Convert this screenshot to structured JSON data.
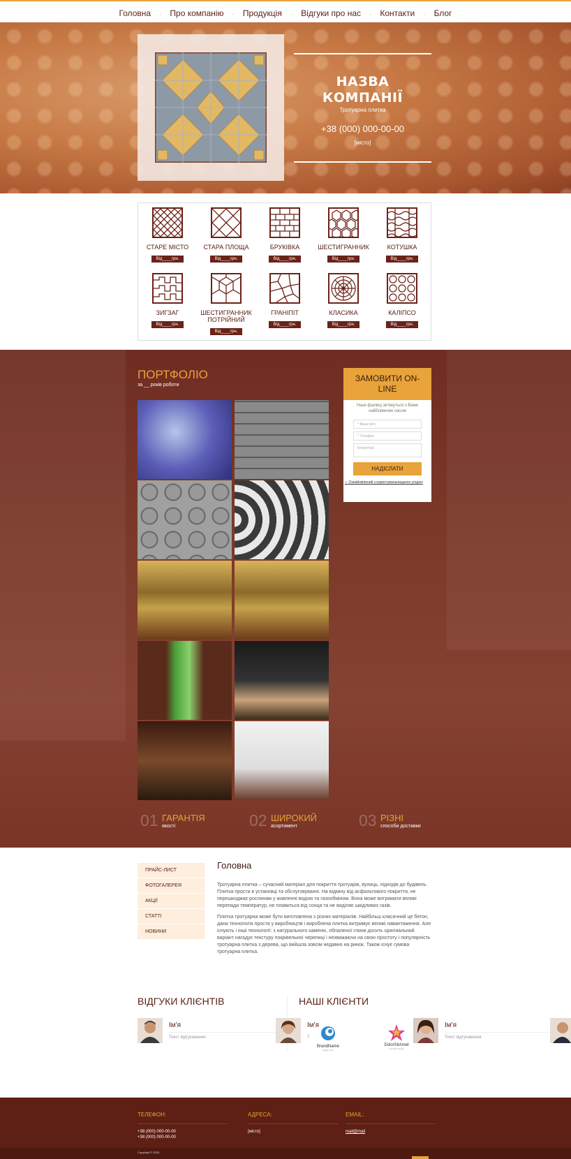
{
  "nav": {
    "items": [
      "Головна",
      "Про компанію",
      "Продукція",
      "Відгуки про нас",
      "Контакти",
      "Блог"
    ],
    "separator": "·"
  },
  "hero": {
    "title_line1": "НАЗВА",
    "title_line2": "КОМПАНІЇ",
    "subtitle": "Тротуарна плитка",
    "phone": "+38 (000) 000-00-00",
    "city": "[місто]"
  },
  "products": [
    {
      "name": "СТАРЕ МІСТО",
      "price": "Від____грн.",
      "icon": "diagonal-grid-icon"
    },
    {
      "name": "СТАРА ПЛОЩА",
      "price": "Від____грн.",
      "icon": "diamond-lattice-icon"
    },
    {
      "name": "БРУКІВКА",
      "price": "Від____грн.",
      "icon": "brick-pattern-icon"
    },
    {
      "name": "ШЕСТИГРАННИК",
      "price": "Від____грн.",
      "icon": "hexagon-pattern-icon"
    },
    {
      "name": "КОТУШКА",
      "price": "Від____грн.",
      "icon": "wave-pattern-icon"
    },
    {
      "name": "ЗИГЗАГ",
      "price": "Від____грн.",
      "icon": "zigzag-pattern-icon"
    },
    {
      "name": "ШЕСТИГРАННИК ПОТРІЙНИЙ",
      "price": "Від____грн.",
      "icon": "triple-hexagon-icon"
    },
    {
      "name": "ГРАНІПІТ",
      "price": "Від____грн.",
      "icon": "granite-pattern-icon"
    },
    {
      "name": "КЛАСИКА",
      "price": "Від____грн.",
      "icon": "circle-classic-icon"
    },
    {
      "name": "КАЛІПСО",
      "price": "Від____грн.",
      "icon": "circles-pattern-icon"
    }
  ],
  "portfolio": {
    "title": "ПОРТФОЛІО",
    "subtitle": "за __ років роботи",
    "images": [
      "blue-cobblestone",
      "grey-paving-blocks",
      "circle-paving-blocks",
      "wave-mosaic",
      "kitchen-interior",
      "kitchen-interior",
      "bookshelf-window",
      "black-modern-bedroom",
      "dark-living-room",
      "white-spiral-staircase"
    ]
  },
  "order": {
    "title": "ЗАМОВИТИ ON-LINE",
    "note": "Наші фахівці зв'яжуться з Вами найблимчим часом",
    "name_placeholder": "* Ваше ім'я",
    "phone_placeholder": "* Телефон",
    "comment_placeholder": "Коментарі",
    "button": "НАДІСЛАТИ",
    "agree": "✓ Ознайомлений з користувальницькою угодою"
  },
  "features": [
    {
      "num": "01",
      "title": "ГАРАНТІЯ",
      "sub": "якості"
    },
    {
      "num": "02",
      "title": "ШИРОКИЙ",
      "sub": "асортимент"
    },
    {
      "num": "03",
      "title": "РІЗНІ",
      "sub": "способи доставки"
    }
  ],
  "sidebar": [
    "ПРАЙС-ЛИСТ",
    "ФОТОГАЛЕРЕЯ",
    "АКЦІЇ",
    "СТАТТІ",
    "НОВИНИ"
  ],
  "main": {
    "title": "Головна",
    "p1": "Тротуарна плитка – сучасний матеріал для покриття тротуарів, вулиць, підходів до будівель. Плитка проста в установці та обслуговуванні. На відміну від асфальтового покриття, не перешкоджає рослинам у живленні водою та газообміном. Вона може витримати великі перепади температур, не плавиться від сонця та не виділяє шкідливих газів.",
    "p2": "Плитка тротуарна може бути виготовлена з різних матеріалів. Найбільш класичний це бетон, дана технологія проста у виробництві і вироблена плитка витримує великі навантаження. Але існують і інші технології: з натурального каменю, обпаленої глини досить оригінальний варіант нагадує текстуру покрівельної черепиці і незважаючи на свою простоту і популярність тротуарна плитка з дерева, що вийшла зовсім недавно на ринок. Також існує гумова тротуарна плитка."
  },
  "reviews": {
    "title": "ВІДГУКИ КЛІЄНТІВ",
    "items": [
      {
        "name": "Ім'я",
        "text": "Текст відгукавання."
      },
      {
        "name": "Ім'я",
        "text": "Т"
      },
      {
        "name": "Ім'я",
        "text": "Текст відгукавання."
      }
    ]
  },
  "clients": {
    "title": "НАШІ КЛІЄНТИ",
    "logos": [
      {
        "name": "BrandName",
        "tag": "slogan here"
      },
      {
        "name": "DolorSitAmet",
        "tag": "company slogan"
      }
    ]
  },
  "footer": {
    "phone_label": "ТЕЛЕФОН:",
    "phone1": "+38 (000) 000-00-00",
    "phone2": "+38 (000) 000-00-00",
    "address_label": "АДРЕСА:",
    "address": "[місто]",
    "email_label": "EMAIL:",
    "email": "mail@mail",
    "copyright": "Copyright © 2025"
  },
  "colors": {
    "accent": "#e8a33a",
    "brown": "#6b2218",
    "footer": "#5e1f14"
  }
}
